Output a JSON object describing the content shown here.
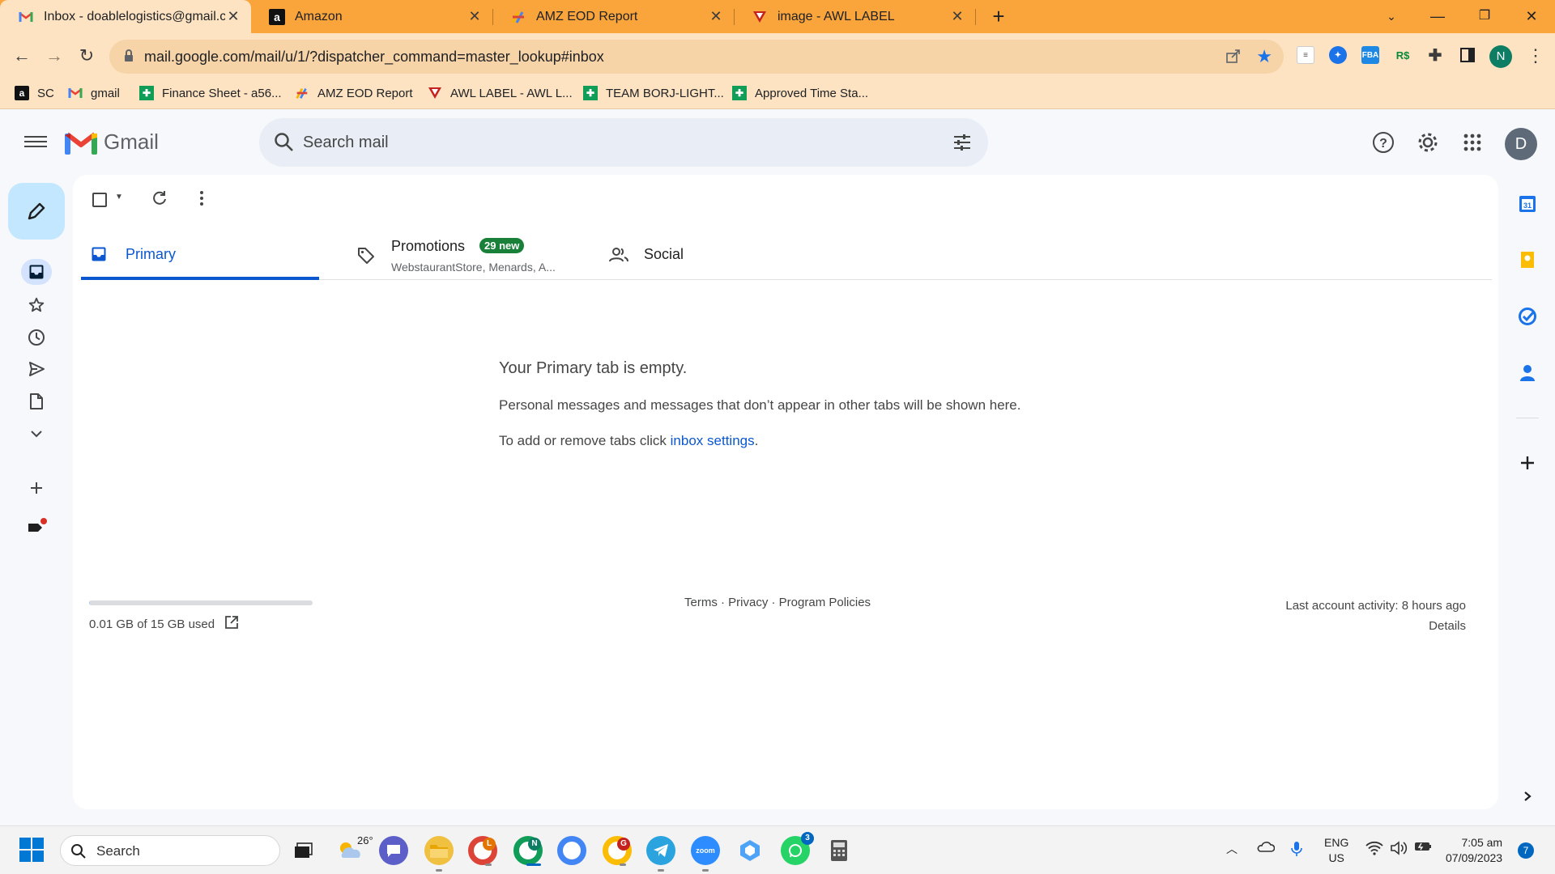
{
  "browser": {
    "tabs": [
      {
        "title": "Inbox - doablelogistics@gmail.co",
        "active": true,
        "icon": "gmail-icon"
      },
      {
        "title": "Amazon",
        "active": false,
        "icon": "amazon-icon"
      },
      {
        "title": "AMZ EOD Report",
        "active": false,
        "icon": "apps-script-icon"
      },
      {
        "title": "image - AWL LABEL",
        "active": false,
        "icon": "awl-icon"
      }
    ],
    "url": "mail.google.com/mail/u/1/?dispatcher_command=master_lookup#inbox",
    "profile_initial": "N",
    "bookmarks": [
      {
        "label": "SC",
        "icon": "amazon-icon"
      },
      {
        "label": "gmail",
        "icon": "gmail-icon"
      },
      {
        "label": "Finance Sheet - a56...",
        "icon": "sheets-icon"
      },
      {
        "label": "AMZ EOD Report",
        "icon": "apps-script-icon"
      },
      {
        "label": "AWL LABEL - AWL L...",
        "icon": "awl-icon"
      },
      {
        "label": "TEAM BORJ-LIGHT...",
        "icon": "sheets-icon"
      },
      {
        "label": "Approved Time Sta...",
        "icon": "sheets-icon"
      }
    ]
  },
  "gmail": {
    "wordmark": "Gmail",
    "search_placeholder": "Search mail",
    "account_initial": "D",
    "tabs": {
      "primary": "Primary",
      "promotions": "Promotions",
      "promotions_badge": "29 new",
      "promotions_sub": "WebstaurantStore, Menards, A...",
      "social": "Social"
    },
    "empty": {
      "heading": "Your Primary tab is empty.",
      "line1": "Personal messages and messages that don’t appear in other tabs will be shown here.",
      "line2_prefix": "To add or remove tabs click ",
      "line2_link": "inbox settings",
      "line2_suffix": "."
    },
    "footer": {
      "storage": "0.01 GB of 15 GB used",
      "storage_fraction": 0.001,
      "links": "Terms · Privacy · Program Policies",
      "activity": "Last account activity: 8 hours ago",
      "details": "Details"
    }
  },
  "taskbar": {
    "search": "Search",
    "weather": "26°",
    "lang_top": "ENG",
    "lang_bottom": "US",
    "time": "7:05 am",
    "date": "07/09/2023",
    "notifications": "7",
    "badges": {
      "chrome1": "L",
      "chrome2": "N",
      "chrome4": "G",
      "whatsapp": "3"
    }
  },
  "colors": {
    "accent": "#0b57d0",
    "browser_frame": "#f9a53c",
    "badge_green": "#188038"
  }
}
